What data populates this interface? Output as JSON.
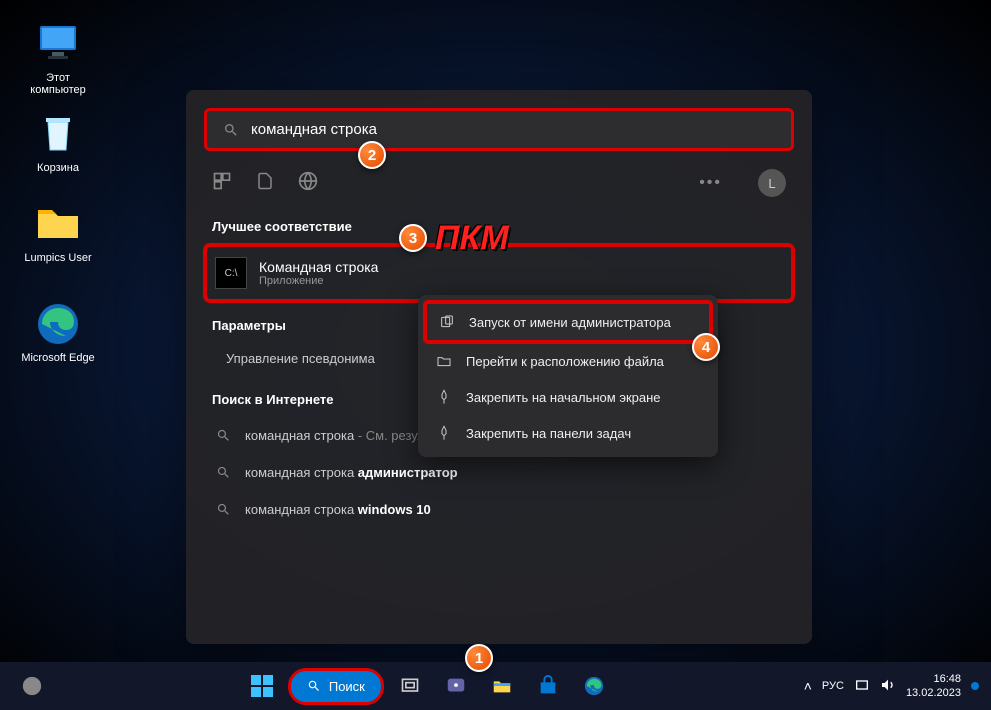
{
  "desktop_icons": [
    {
      "label": "Этот компьютер"
    },
    {
      "label": "Корзина"
    },
    {
      "label": "Lumpics User"
    },
    {
      "label": "Microsoft Edge"
    }
  ],
  "search": {
    "query": "командная строка",
    "best_match_hdr": "Лучшее соответствие",
    "result": {
      "title": "Командная строка",
      "subtitle": "Приложение"
    },
    "params_hdr": "Параметры",
    "params_item": "Управление псевдонима",
    "web_hdr": "Поиск в Интернете",
    "web": [
      {
        "text": "командная строка",
        "suffix": " - См. результаты в Интернете"
      },
      {
        "text": "командная строка ",
        "bold": "администратор"
      },
      {
        "text": "командная строка ",
        "bold": "windows 10"
      }
    ],
    "avatar": "L"
  },
  "context_menu": [
    {
      "label": "Запуск от имени администратора",
      "icon": "admin"
    },
    {
      "label": "Перейти к расположению файла",
      "icon": "folder"
    },
    {
      "label": "Закрепить на начальном экране",
      "icon": "pin"
    },
    {
      "label": "Закрепить на панели задач",
      "icon": "pin"
    }
  ],
  "taskbar": {
    "search_label": "Поиск",
    "lang": "РУС",
    "time": "16:48",
    "date": "13.02.2023"
  },
  "annotations": {
    "pkm": "ПКМ"
  }
}
